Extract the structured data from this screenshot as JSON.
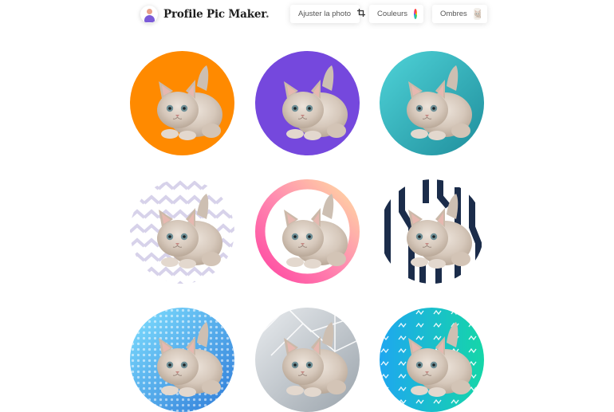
{
  "app": {
    "title": "Profile Pic Maker",
    "title_dot": "."
  },
  "toolbar": {
    "adjust_label": "Ajuster la photo",
    "colors_label": "Couleurs",
    "shadows_label": "Ombres"
  },
  "colors": {
    "orange": "#ff8a00",
    "purple": "#7548dd",
    "teal": "#35b9c4",
    "navy": "#1b2c4a",
    "lavender": "#d7d2ea"
  },
  "tiles": [
    {
      "background": "solid-orange"
    },
    {
      "background": "solid-purple"
    },
    {
      "background": "teal-gradient"
    },
    {
      "background": "lavender-chevrons"
    },
    {
      "background": "pink-orange-ring"
    },
    {
      "background": "navy-zebra-stripes"
    },
    {
      "background": "blue-halftone-dots"
    },
    {
      "background": "grey-geometric"
    },
    {
      "background": "teal-squiggles"
    }
  ]
}
